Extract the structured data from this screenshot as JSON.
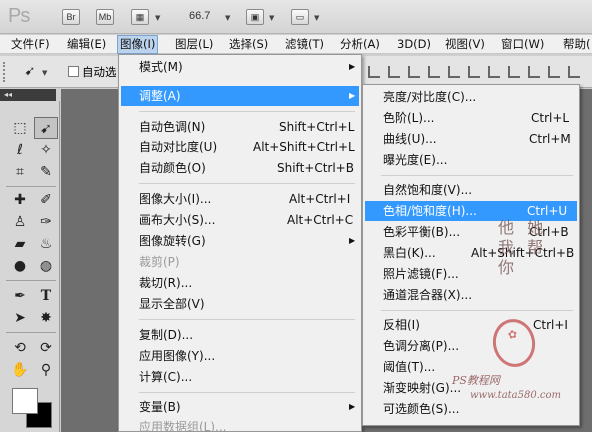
{
  "app": {
    "logo": "Ps",
    "zoom": "66.7"
  },
  "toolbar_buttons": [
    "Br",
    "Mb"
  ],
  "menubar": [
    {
      "label": "文件(F)",
      "active": false
    },
    {
      "label": "编辑(E)",
      "active": false
    },
    {
      "label": "图像(I)",
      "active": true
    },
    {
      "label": "图层(L)",
      "active": false
    },
    {
      "label": "选择(S)",
      "active": false
    },
    {
      "label": "滤镜(T)",
      "active": false
    },
    {
      "label": "分析(A)",
      "active": false
    },
    {
      "label": "3D(D)",
      "active": false
    },
    {
      "label": "视图(V)",
      "active": false
    },
    {
      "label": "窗口(W)",
      "active": false
    },
    {
      "label": "帮助(",
      "active": false
    }
  ],
  "options_bar": {
    "auto_select_label": "自动选"
  },
  "panel_toggle": "◂◂",
  "image_menu": [
    {
      "label": "模式(M)",
      "shortcut": "",
      "submenu": true
    },
    {
      "label": "调整(A)",
      "shortcut": "",
      "submenu": true,
      "highlight": true
    },
    {
      "label": "自动色调(N)",
      "shortcut": "Shift+Ctrl+L"
    },
    {
      "label": "自动对比度(U)",
      "shortcut": "Alt+Shift+Ctrl+L"
    },
    {
      "label": "自动颜色(O)",
      "shortcut": "Shift+Ctrl+B"
    },
    {
      "label": "图像大小(I)...",
      "shortcut": "Alt+Ctrl+I"
    },
    {
      "label": "画布大小(S)...",
      "shortcut": "Alt+Ctrl+C"
    },
    {
      "label": "图像旋转(G)",
      "shortcut": "",
      "submenu": true
    },
    {
      "label": "裁剪(P)",
      "shortcut": "",
      "disabled": true
    },
    {
      "label": "裁切(R)...",
      "shortcut": ""
    },
    {
      "label": "显示全部(V)",
      "shortcut": ""
    },
    {
      "label": "复制(D)...",
      "shortcut": ""
    },
    {
      "label": "应用图像(Y)...",
      "shortcut": ""
    },
    {
      "label": "计算(C)...",
      "shortcut": ""
    },
    {
      "label": "变量(B)",
      "shortcut": "",
      "submenu": true
    },
    {
      "label": "应用数据组(L)...",
      "shortcut": "",
      "disabled": true
    }
  ],
  "adjust_menu": [
    {
      "label": "亮度/对比度(C)...",
      "shortcut": ""
    },
    {
      "label": "色阶(L)...",
      "shortcut": "Ctrl+L"
    },
    {
      "label": "曲线(U)...",
      "shortcut": "Ctrl+M"
    },
    {
      "label": "曝光度(E)...",
      "shortcut": ""
    },
    {
      "label": "自然饱和度(V)...",
      "shortcut": ""
    },
    {
      "label": "色相/饱和度(H)...",
      "shortcut": "Ctrl+U",
      "highlight": true
    },
    {
      "label": "色彩平衡(B)...",
      "shortcut": "Ctrl+B"
    },
    {
      "label": "黑白(K)...",
      "shortcut": "Alt+Shift+Ctrl+B"
    },
    {
      "label": "照片滤镜(F)...",
      "shortcut": ""
    },
    {
      "label": "通道混合器(X)...",
      "shortcut": ""
    },
    {
      "label": "反相(I)",
      "shortcut": "Ctrl+I"
    },
    {
      "label": "色调分离(P)...",
      "shortcut": ""
    },
    {
      "label": "阈值(T)...",
      "shortcut": ""
    },
    {
      "label": "渐变映射(G)...",
      "shortcut": ""
    },
    {
      "label": "可选颜色(S)...",
      "shortcut": ""
    }
  ],
  "watermark": {
    "signature": "他 她 我 帮 你",
    "site": "PS教程网",
    "url": "www.tata580.com"
  },
  "tool_icons": [
    "move-icon",
    "marquee-icon",
    "lasso-icon",
    "magic-wand-icon",
    "crop-icon",
    "eyedropper-icon",
    "healing-brush-icon",
    "brush-icon",
    "clone-stamp-icon",
    "history-brush-icon",
    "eraser-icon",
    "paint-bucket-icon",
    "blur-icon",
    "dodge-icon",
    "pen-icon",
    "type-icon",
    "path-selection-icon",
    "shape-icon",
    "3d-rotate-icon",
    "3d-orbit-icon",
    "hand-icon",
    "zoom-icon"
  ],
  "colors": {
    "highlight": "#3399ff",
    "menu_bg": "#f0f0f0",
    "canvas": "#6e6e6e"
  }
}
